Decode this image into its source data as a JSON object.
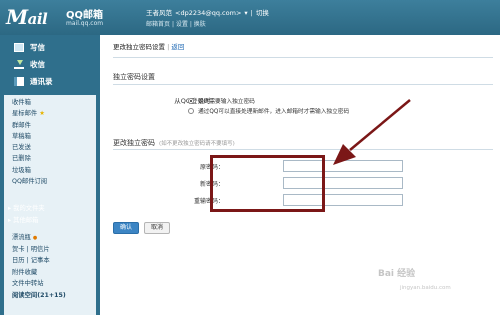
{
  "header": {
    "logo": "M",
    "logo_rest": "ail",
    "brand": "QQ邮箱",
    "domain": "mail.qq.com",
    "user_name": "王者风范",
    "user_email": "<dp2234@qq.com>",
    "user_caret": "▾",
    "switch_label": "切换",
    "links": [
      "邮箱首页",
      "设置",
      "换肤"
    ],
    "link_sep": "|"
  },
  "sidebar": {
    "quick": [
      {
        "label": "写信",
        "icon": "write-icon"
      },
      {
        "label": "收信",
        "icon": "inbox-download-icon"
      },
      {
        "label": "通讯录",
        "icon": "address-book-icon"
      }
    ],
    "folders": [
      "收件箱",
      "星标邮件",
      "群邮件",
      "草稿箱",
      "已发送",
      "已删除",
      "垃圾箱",
      "QQ邮件订阅"
    ],
    "star": "★",
    "my_folders": "我的文件夹",
    "other_mailboxes": "其他邮箱",
    "tools": [
      "漂流瓶",
      "贺卡",
      "明信片",
      "日历",
      "记事本",
      "附件收藏",
      "文件中转站",
      "阅读空间(21+15)"
    ],
    "tools_bullet": "●"
  },
  "main": {
    "breadcrumb_title": "更改独立密码设置",
    "breadcrumb_sep": "|",
    "back_label": "返回",
    "section1_title": "独立密码设置",
    "login_label": "从QQ登录时：",
    "option1": "始终需要输入独立密码",
    "option2": "通过QQ可以直接处理新邮件，进入邮箱时才需输入独立密码",
    "section2_title": "更改独立密码",
    "section2_hint": "(如不更改独立密码请不要填写)",
    "old_pw_label": "原密码：",
    "new_pw_label": "新密码：",
    "confirm_pw_label": "重输密码：",
    "ok_label": "确认",
    "cancel_label": "取消"
  },
  "watermark": {
    "text": "Bai 经验",
    "sub": "jingyan.baidu.com"
  },
  "colors": {
    "header_bg": "#2c6883",
    "sidebar_bg": "#2f6f8c",
    "panel_bg": "#e7f1f6",
    "highlight_frame": "#7b1717",
    "arrow": "#7b1717",
    "primary_button": "#3c85c4"
  }
}
